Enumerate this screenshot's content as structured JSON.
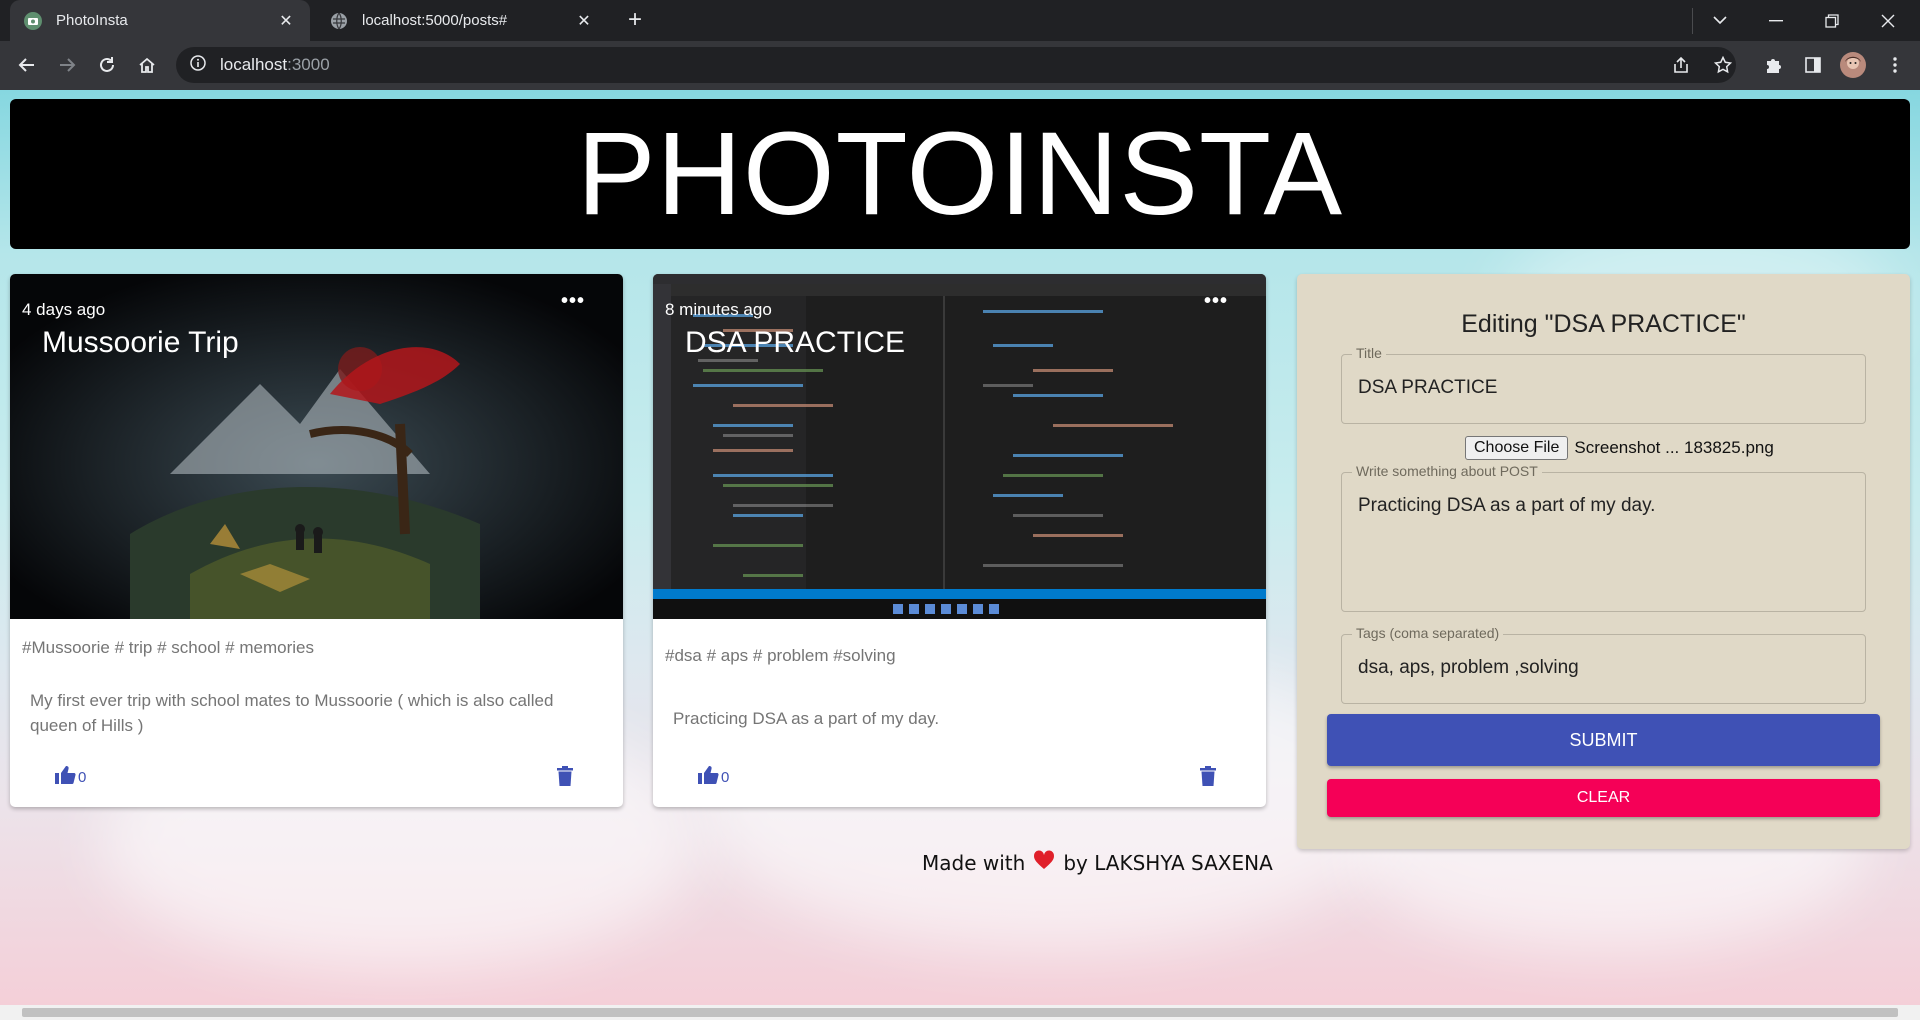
{
  "browser": {
    "tabs": [
      {
        "title": "PhotoInsta",
        "active": true
      },
      {
        "title": "localhost:5000/posts#",
        "active": false
      }
    ],
    "url_host": "localhost",
    "url_port": ":3000"
  },
  "header": {
    "title": "PHOTOINSTA"
  },
  "posts": [
    {
      "time": "4 days ago",
      "title": "Mussoorie Trip",
      "tags": "#Mussoorie # trip # school # memories",
      "message": "My first ever trip with school mates to Mussoorie ( which is also called queen of Hills )",
      "likes": "0"
    },
    {
      "time": "8 minutes ago",
      "title": "DSA PRACTICE",
      "tags": "#dsa # aps # problem #solving",
      "message": "Practicing DSA as a part of my day.",
      "likes": "0"
    }
  ],
  "form": {
    "heading": "Editing \"DSA PRACTICE\"",
    "title_label": "Title",
    "title_value": "DSA PRACTICE",
    "file_button": "Choose File",
    "file_name": "Screenshot ... 183825.png",
    "message_label": "Write something about POST",
    "message_value": "Practicing DSA as a part of my day.",
    "tags_label": "Tags (coma separated)",
    "tags_value": "dsa, aps, problem ,solving",
    "submit_label": "SUBMIT",
    "clear_label": "CLEAR"
  },
  "footer": {
    "before": "Made with",
    "after": "by LAKSHYA SAXENA"
  },
  "colors": {
    "primary": "#3f51b5",
    "secondary": "#f50057",
    "form_bg": "#e0d9c7"
  }
}
